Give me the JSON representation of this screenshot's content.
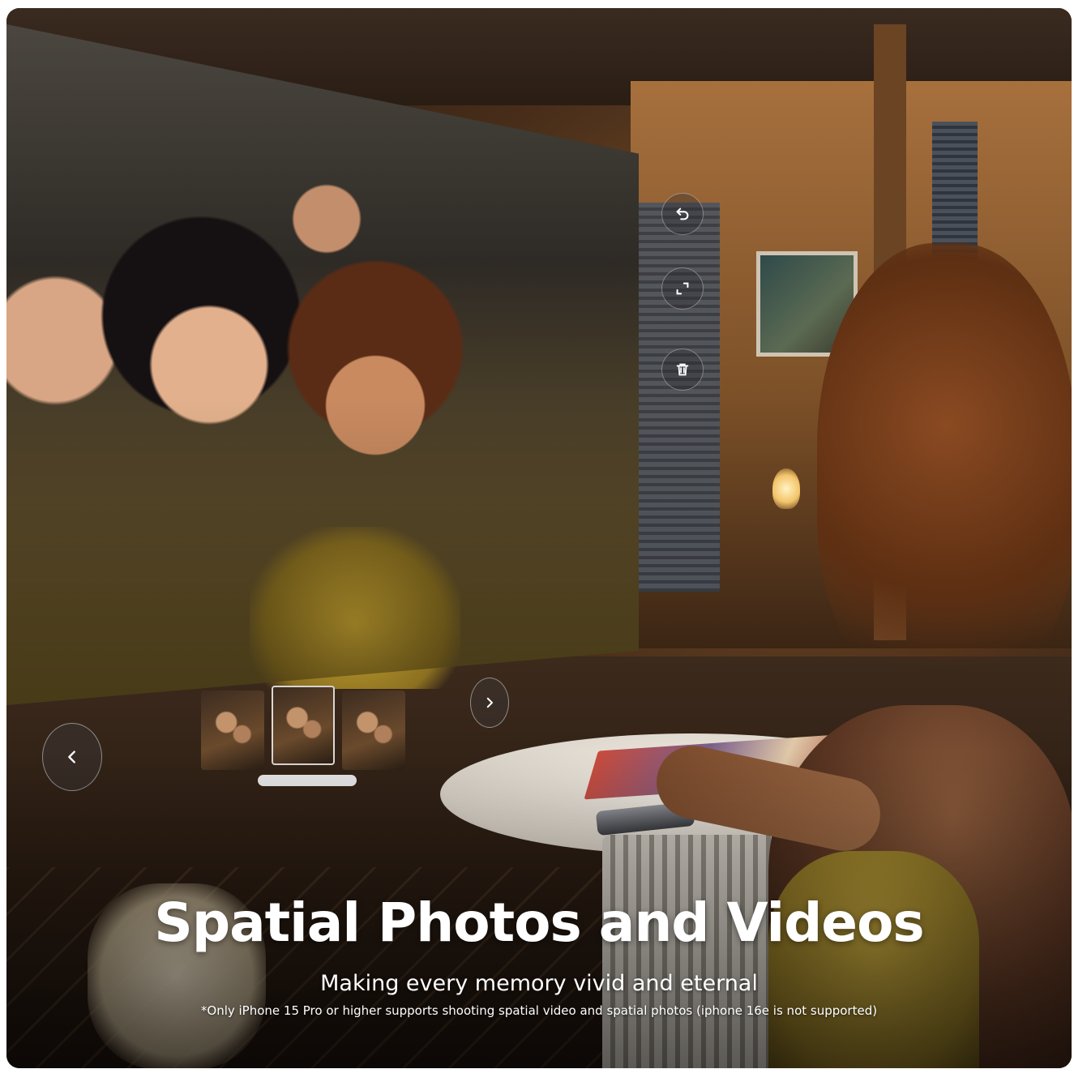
{
  "hero": {
    "title": "Spatial Photos and Videos",
    "subtitle": "Making every memory vivid and eternal",
    "footnote": "*Only iPhone 15 Pro or higher supports shooting spatial video and spatial photos (iphone 16e is not supported)"
  },
  "viewer": {
    "controls": [
      {
        "icon": "undo-icon"
      },
      {
        "icon": "fullscreen-icon"
      },
      {
        "icon": "trash-icon"
      }
    ],
    "thumbnails": [
      {
        "active": false
      },
      {
        "active": true
      },
      {
        "active": false
      }
    ],
    "nav": {
      "prev_icon": "chevron-left-icon",
      "next_icon": "chevron-right-icon"
    }
  },
  "colors": {
    "text": "#ffffff",
    "button_border": "#ffffff",
    "scrubber": "#e6e6e6"
  }
}
